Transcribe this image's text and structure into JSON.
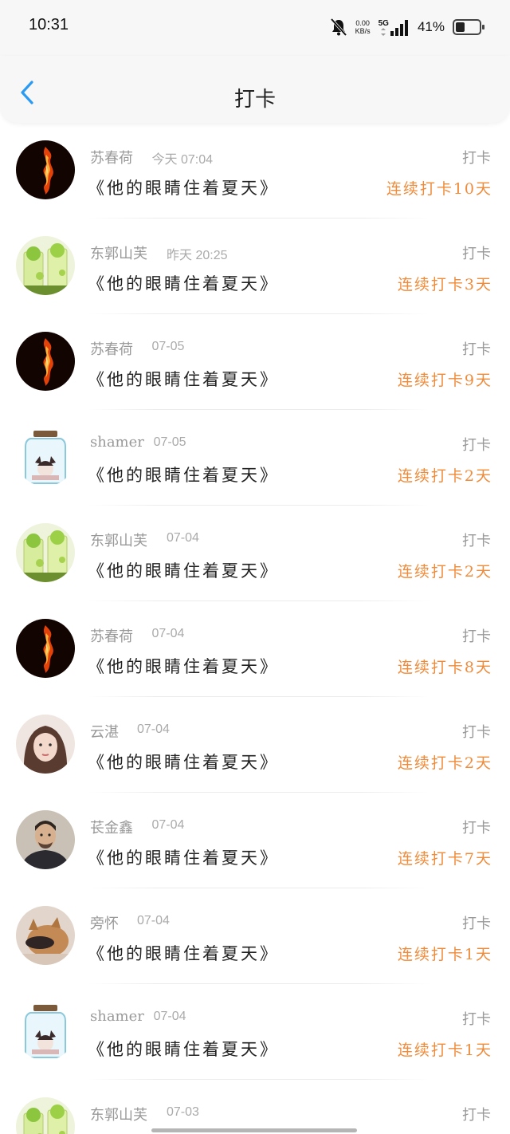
{
  "status_bar": {
    "time": "10:31",
    "net_speed": "0.00",
    "net_unit": "KB/s",
    "network": "5G",
    "battery_pct": "41%",
    "battery_level": 0.41
  },
  "header": {
    "title": "打卡",
    "back_icon": "chevron-left-icon",
    "accent_color": "#2b9af3"
  },
  "colors": {
    "streak": "#f08b3a",
    "meta": "#999999"
  },
  "items": [
    {
      "name": "苏春荷",
      "time": "今天 07:04",
      "title": "《他的眼睛住着夏天》",
      "action": "打卡",
      "streak": "连续打卡10天",
      "avatar": "fire-avatar"
    },
    {
      "name": "东郭山芙",
      "time": "昨天 20:25",
      "title": "《他的眼睛住着夏天》",
      "action": "打卡",
      "streak": "连续打卡3天",
      "avatar": "lime-drink-avatar"
    },
    {
      "name": "苏春荷",
      "time": "07-05",
      "title": "《他的眼睛住着夏天》",
      "action": "打卡",
      "streak": "连续打卡9天",
      "avatar": "fire-avatar"
    },
    {
      "name": "shamer",
      "time": "07-05",
      "title": "《他的眼睛住着夏天》",
      "action": "打卡",
      "streak": "连续打卡2天",
      "avatar": "jar-avatar"
    },
    {
      "name": "东郭山芙",
      "time": "07-04",
      "title": "《他的眼睛住着夏天》",
      "action": "打卡",
      "streak": "连续打卡2天",
      "avatar": "lime-drink-avatar"
    },
    {
      "name": "苏春荷",
      "time": "07-04",
      "title": "《他的眼睛住着夏天》",
      "action": "打卡",
      "streak": "连续打卡8天",
      "avatar": "fire-avatar"
    },
    {
      "name": "云湛",
      "time": "07-04",
      "title": "《他的眼睛住着夏天》",
      "action": "打卡",
      "streak": "连续打卡2天",
      "avatar": "girl-avatar"
    },
    {
      "name": "苌金鑫",
      "time": "07-04",
      "title": "《他的眼睛住着夏天》",
      "action": "打卡",
      "streak": "连续打卡7天",
      "avatar": "man-avatar"
    },
    {
      "name": "旁怀",
      "time": "07-04",
      "title": "《他的眼睛住着夏天》",
      "action": "打卡",
      "streak": "连续打卡1天",
      "avatar": "cat-avatar"
    },
    {
      "name": "shamer",
      "time": "07-04",
      "title": "《他的眼睛住着夏天》",
      "action": "打卡",
      "streak": "连续打卡1天",
      "avatar": "jar-avatar"
    },
    {
      "name": "东郭山芙",
      "time": "07-03",
      "title": "",
      "action": "打卡",
      "streak": "",
      "avatar": "lime-drink-avatar"
    }
  ]
}
